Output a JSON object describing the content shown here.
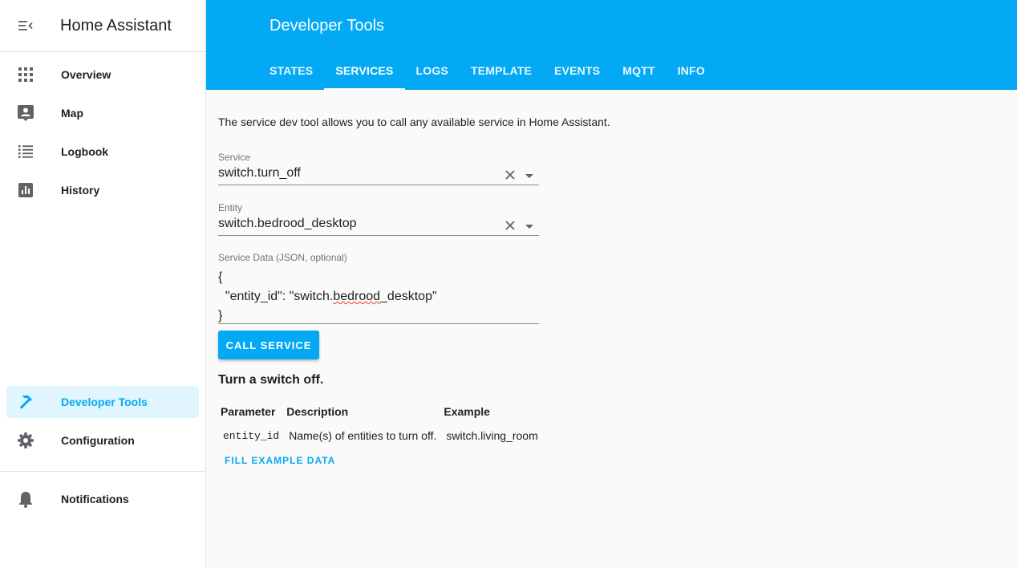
{
  "sidebar": {
    "title": "Home Assistant",
    "menu_icon": "menu-collapse-icon",
    "items": [
      {
        "label": "Overview",
        "icon": "grid-icon"
      },
      {
        "label": "Map",
        "icon": "account-box-icon"
      },
      {
        "label": "Logbook",
        "icon": "format-list-icon"
      },
      {
        "label": "History",
        "icon": "chart-box-icon"
      },
      {
        "label": "Developer Tools",
        "icon": "hammer-icon",
        "active": true
      },
      {
        "label": "Configuration",
        "icon": "gear-icon"
      },
      {
        "label": "Notifications",
        "icon": "bell-icon"
      }
    ]
  },
  "header": {
    "title": "Developer Tools",
    "tabs": [
      {
        "label": "STATES"
      },
      {
        "label": "SERVICES",
        "active": true
      },
      {
        "label": "LOGS"
      },
      {
        "label": "TEMPLATE"
      },
      {
        "label": "EVENTS"
      },
      {
        "label": "MQTT"
      },
      {
        "label": "INFO"
      }
    ]
  },
  "main": {
    "intro": "The service dev tool allows you to call any available service in Home Assistant.",
    "service_field": {
      "label": "Service",
      "value": "switch.turn_off"
    },
    "entity_field": {
      "label": "Entity",
      "value": "switch.bedrood_desktop"
    },
    "service_data": {
      "label": "Service Data (JSON, optional)",
      "line1": "{",
      "line2_prefix": "  \"entity_id\": \"switch.",
      "line2_misspelled": "bedrood",
      "line2_suffix": "_desktop\"",
      "line3": "}"
    },
    "call_button": "CALL SERVICE",
    "service_description": "Turn a switch off.",
    "table": {
      "headers": [
        "Parameter",
        "Description",
        "Example"
      ],
      "rows": [
        {
          "parameter": "entity_id",
          "description": "Name(s) of entities to turn off.",
          "example": "switch.living_room"
        }
      ]
    },
    "fill_example": "FILL EXAMPLE DATA"
  },
  "colors": {
    "accent": "#03a9f4",
    "active_bg": "#e1f5fe"
  }
}
